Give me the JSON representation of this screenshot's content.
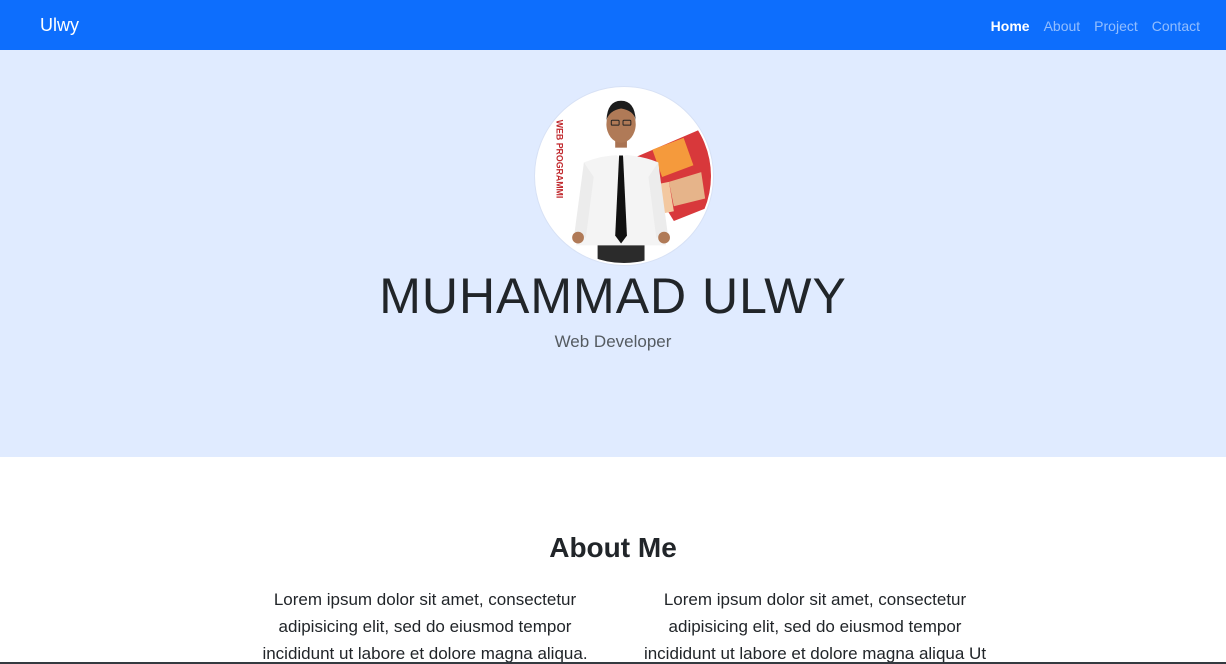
{
  "navbar": {
    "brand": "Ulwy",
    "links": [
      {
        "label": "Home",
        "active": true
      },
      {
        "label": "About",
        "active": false
      },
      {
        "label": "Project",
        "active": false
      },
      {
        "label": "Contact",
        "active": false
      }
    ]
  },
  "hero": {
    "name": "MUHAMMAD ULWY",
    "role": "Web Developer",
    "avatar_banner_text": "— WEB PROGRAMMI"
  },
  "about": {
    "title": "About Me",
    "col_left": "Lorem ipsum dolor sit amet, consectetur adipisicing elit, sed do eiusmod tempor incididunt ut labore et dolore magna aliqua.",
    "col_right": "Lorem ipsum dolor sit amet, consectetur adipisicing elit, sed do eiusmod tempor incididunt ut labore et dolore magna aliqua Ut"
  },
  "colors": {
    "navbar_bg": "#0d6efd",
    "hero_bg": "#e0ebff",
    "text": "#212529"
  }
}
